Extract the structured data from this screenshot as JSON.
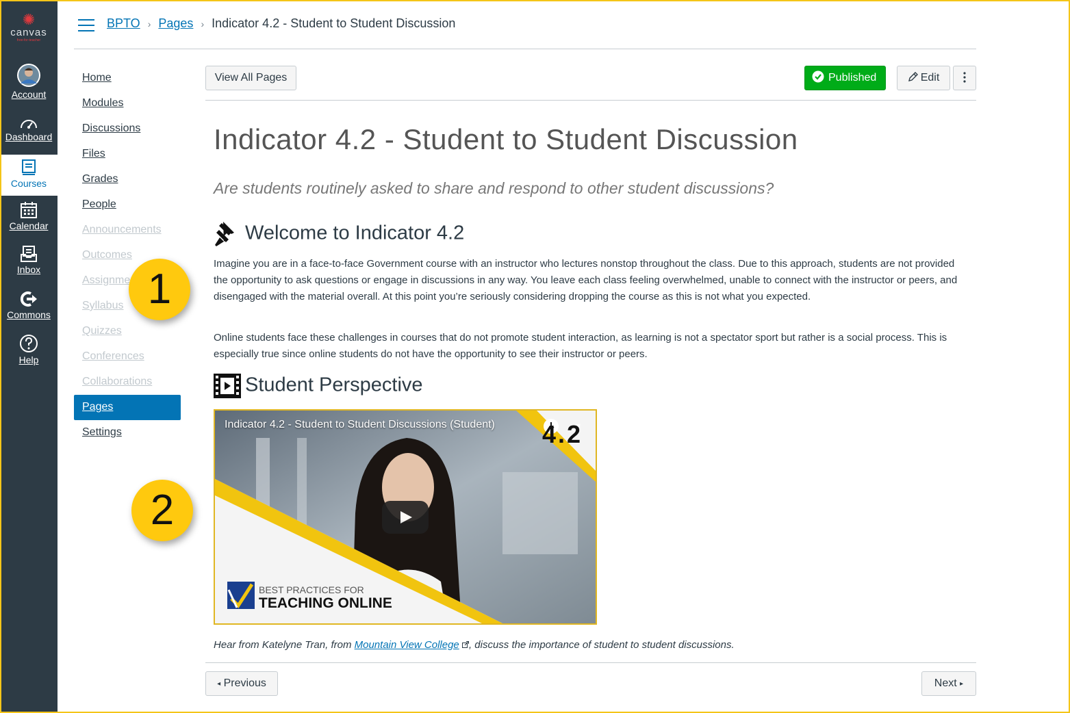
{
  "global_nav": {
    "logo": {
      "word": "canvas",
      "sub": "free-for-teacher"
    },
    "items": [
      {
        "label": "Account",
        "icon": "avatar"
      },
      {
        "label": "Dashboard",
        "icon": "dashboard-icon"
      },
      {
        "label": "Courses",
        "icon": "courses-icon"
      },
      {
        "label": "Calendar",
        "icon": "calendar-icon"
      },
      {
        "label": "Inbox",
        "icon": "inbox-icon"
      },
      {
        "label": "Commons",
        "icon": "commons-icon"
      },
      {
        "label": "Help",
        "icon": "help-icon"
      }
    ],
    "active_color": "#0374b5"
  },
  "breadcrumb": {
    "course": "BPTO",
    "section": "Pages",
    "current": "Indicator 4.2 - Student to Student Discussion"
  },
  "course_nav": [
    {
      "label": "Home"
    },
    {
      "label": "Modules"
    },
    {
      "label": "Discussions"
    },
    {
      "label": "Files"
    },
    {
      "label": "Grades"
    },
    {
      "label": "People"
    },
    {
      "label": "Announcements"
    },
    {
      "label": "Outcomes"
    },
    {
      "label": "Assignments"
    },
    {
      "label": "Syllabus"
    },
    {
      "label": "Quizzes"
    },
    {
      "label": "Conferences"
    },
    {
      "label": "Collaborations"
    },
    {
      "label": "Pages"
    },
    {
      "label": "Settings"
    }
  ],
  "callouts": {
    "one": "1",
    "two": "2"
  },
  "toolbar": {
    "view_all": "View All Pages",
    "published": "Published",
    "edit": "Edit"
  },
  "page": {
    "title": "Indicator 4.2 - Student to Student Discussion",
    "question": "Are students routinely asked to share and respond to other student discussions?",
    "welcome_heading": "Welcome to Indicator 4.2",
    "para1": "Imagine you are in a face-to-face Government course with an instructor who lectures nonstop throughout the class. Due to this approach, students are not provided the opportunity to ask questions or engage in discussions in any way. You leave each class feeling overwhelmed, unable to connect with the instructor or peers, and disengaged with the material overall. At this point you’re seriously considering dropping the course as this is not what you expected.",
    "para2": "Online students face these challenges in courses that do not promote student interaction, as learning is not a spectator sport but rather is a social process. This is especially true since online students do not have the opportunity to see their instructor or peers.",
    "perspective_heading": "Student Perspective",
    "video": {
      "title": "Indicator 4.2 - Student to Student Discussions (Student)",
      "badge": "4.2",
      "brand_line1": "BEST PRACTICES FOR",
      "brand_line2": "TEACHING ONLINE"
    },
    "caption_pre": "Hear from Katelyne Tran, from ",
    "caption_link": "Mountain View College",
    "caption_post": ", discuss the importance of student to student discussions."
  },
  "footer": {
    "previous": "Previous",
    "next": "Next"
  }
}
